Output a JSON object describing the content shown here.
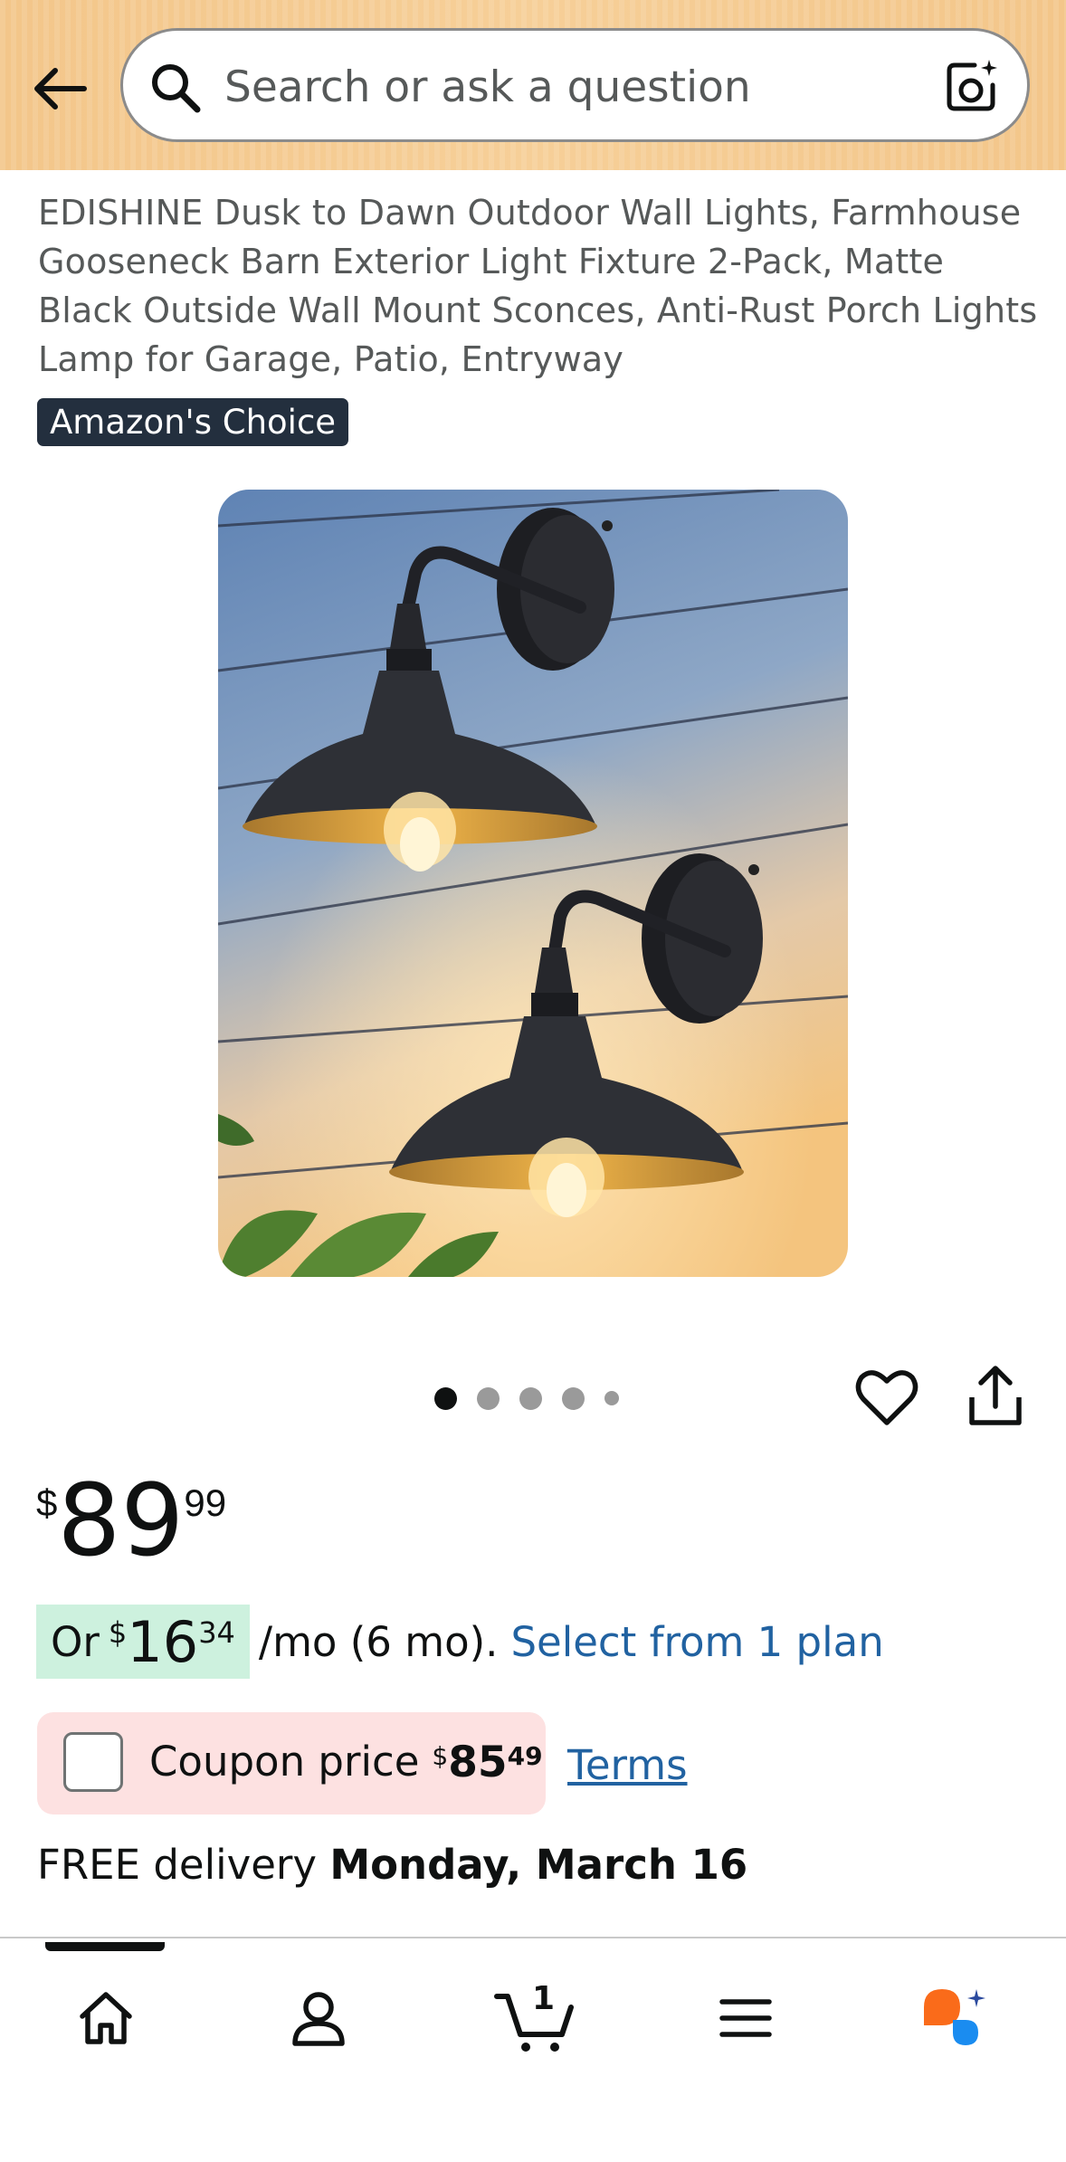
{
  "header": {
    "search_placeholder": "Search or ask a question"
  },
  "product": {
    "title": "EDISHINE Dusk to Dawn Outdoor Wall Lights, Farmhouse Gooseneck Barn Exterior Light Fixture 2-Pack, Matte Black Outside Wall Mount Sconces, Anti-Rust Porch Lights Lamp for Garage, Patio, Entryway",
    "badge": "Amazon's Choice"
  },
  "gallery": {
    "image_count": 5,
    "active_index": 0
  },
  "price": {
    "symbol": "$",
    "whole": "89",
    "fraction": "99"
  },
  "monthly": {
    "prefix": "Or",
    "symbol": "$",
    "whole": "16",
    "fraction": "34",
    "suffix": "/mo (6 mo).",
    "plan_link": "Select from 1 plan"
  },
  "coupon": {
    "label": "Coupon price",
    "symbol": "$",
    "whole": "85",
    "fraction": "49",
    "terms": "Terms"
  },
  "delivery": {
    "prefix": "FREE delivery",
    "date": "Monday, March 16"
  },
  "bottom_nav": {
    "cart_count": "1"
  },
  "colors": {
    "header_bg": "#f3c68a",
    "badge_bg": "#232f3e",
    "link": "#2162a1",
    "monthly_highlight": "#cdf1de",
    "coupon_bg": "#fde1e1"
  }
}
